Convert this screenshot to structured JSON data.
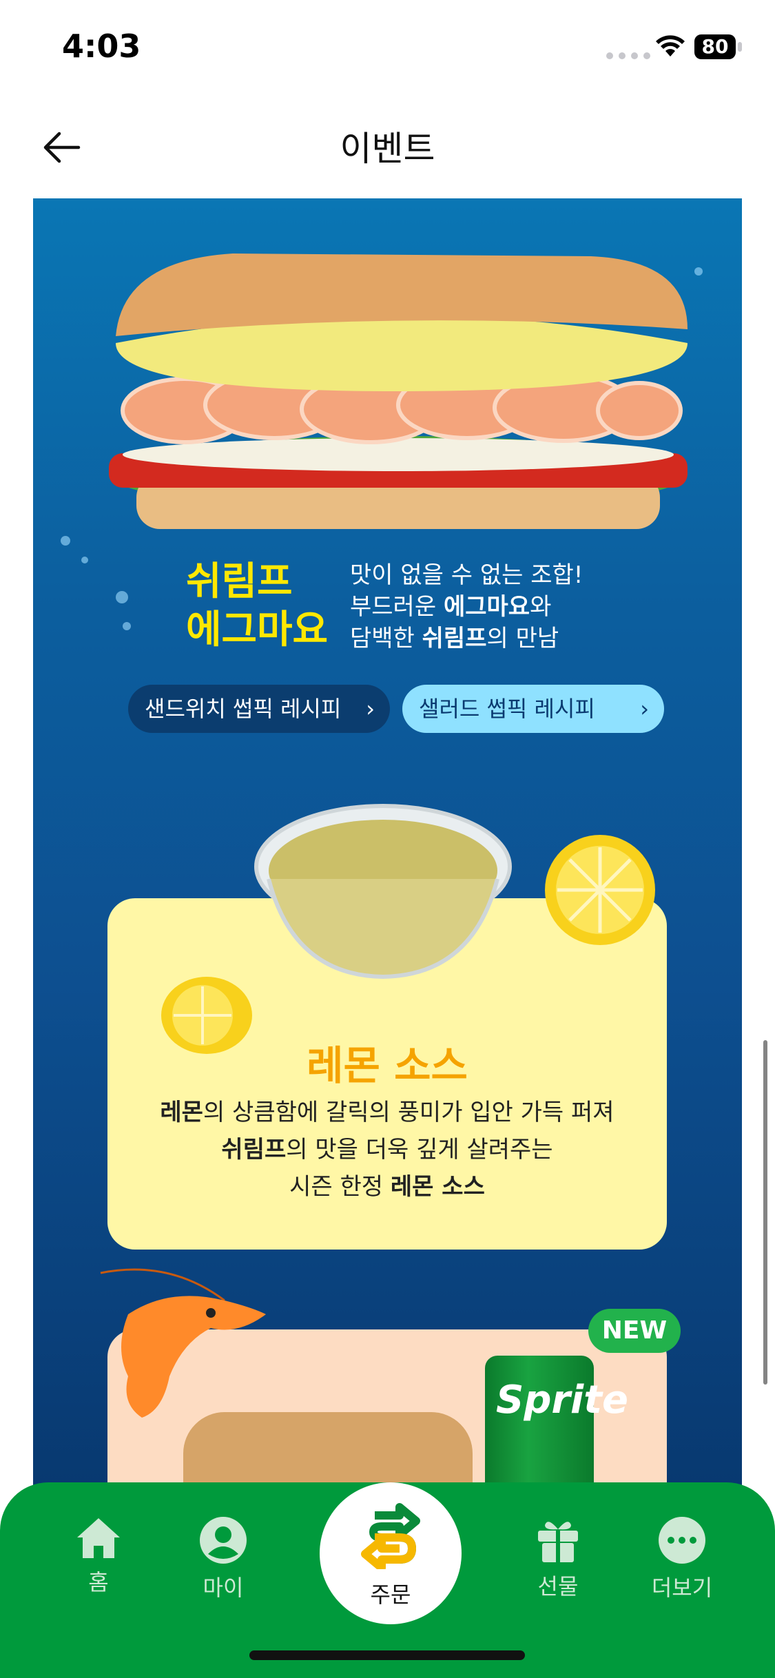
{
  "status_bar": {
    "time": "4:03",
    "battery": "80"
  },
  "header": {
    "title": "이벤트"
  },
  "event": {
    "menu_name_line1": "쉬림프",
    "menu_name_line2": "에그마요",
    "desc_line1": "맛이 없을 수 없는 조합!",
    "desc_line2_pre": "부드러운 ",
    "desc_line2_bold": "에그마요",
    "desc_line2_post": "와",
    "desc_line3_pre": "담백한 ",
    "desc_line3_bold": "쉬림프",
    "desc_line3_post": "의 만남",
    "btn_sandwich": "샌드위치 썹픽 레시피",
    "btn_salad": "샐러드 썹픽 레시피",
    "sauce_title": "레몬 소스",
    "sauce_l1_bold": "레몬",
    "sauce_l1_rest": "의 상큼함에 갈릭의 풍미가 입안 가득 퍼져",
    "sauce_l2_bold": "쉬림프",
    "sauce_l2_rest": "의 맛을 더욱 깊게 살려주는",
    "sauce_l3_pre": "시즌 한정 ",
    "sauce_l3_bold": "레몬 소스",
    "new_badge": "NEW",
    "can_label": "Sprite"
  },
  "nav": {
    "home": "홈",
    "my": "마이",
    "order": "주문",
    "gift": "선물",
    "more": "더보기"
  },
  "colors": {
    "brand_green": "#009a3c",
    "banner_blue": "#0c5f9f",
    "accent_yellow": "#ffe800"
  }
}
